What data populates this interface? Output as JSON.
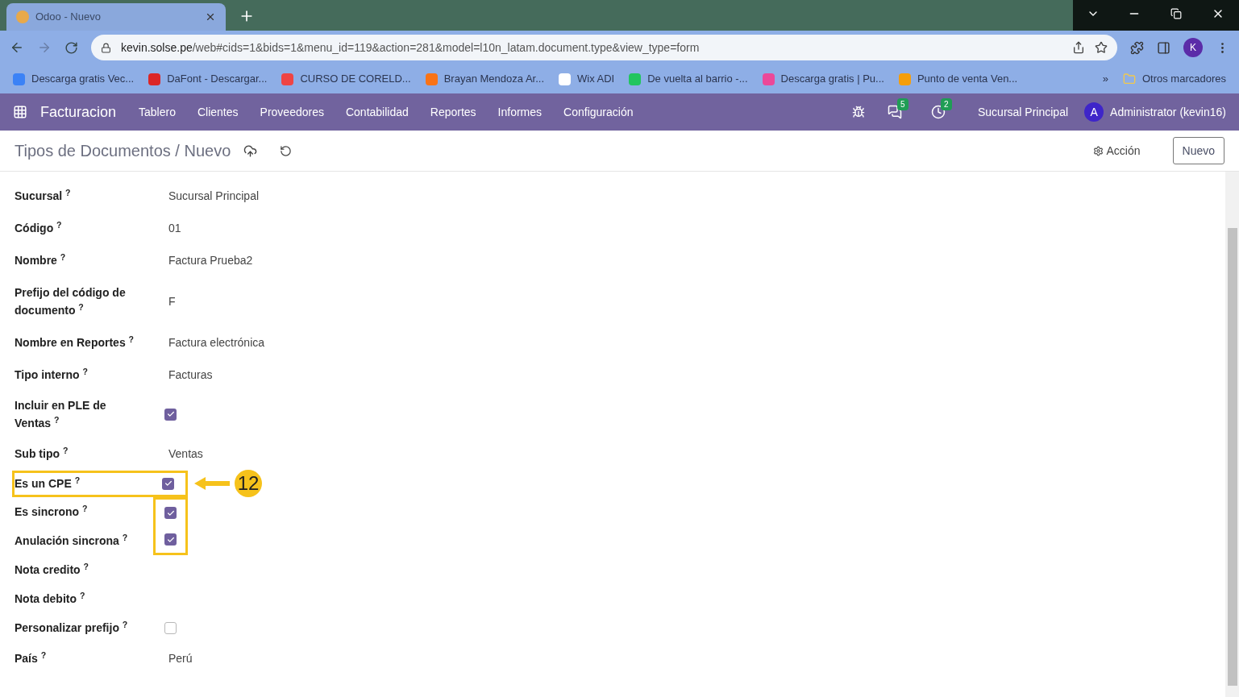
{
  "browser": {
    "tab_title": "Odoo - Nuevo",
    "url_host": "kevin.solse.pe",
    "url_path": "/web#cids=1&bids=1&menu_id=119&action=281&model=l10n_latam.document.type&view_type=form",
    "profile_initial": "K",
    "bookmarks": [
      {
        "label": "Descarga gratis Vec...",
        "color": "#3b82f6"
      },
      {
        "label": "DaFont - Descargar...",
        "color": "#dc2626"
      },
      {
        "label": "CURSO DE CORELD...",
        "color": "#ef4444"
      },
      {
        "label": "Brayan Mendoza Ar...",
        "color": "#f97316"
      },
      {
        "label": "Wix ADI",
        "color": "#ffffff"
      },
      {
        "label": "De vuelta al barrio -...",
        "color": "#22c55e"
      },
      {
        "label": "Descarga gratis | Pu...",
        "color": "#ec4899"
      },
      {
        "label": "Punto de venta Ven...",
        "color": "#f59e0b"
      }
    ],
    "more": "»",
    "other_bookmarks": "Otros marcadores"
  },
  "navbar": {
    "app": "Facturacion",
    "menu": [
      "Tablero",
      "Clientes",
      "Proveedores",
      "Contabilidad",
      "Reportes",
      "Informes",
      "Configuración"
    ],
    "messages_count": "5",
    "activities_count": "2",
    "company": "Sucursal Principal",
    "user_initial": "A",
    "user": "Administrator (kevin16)"
  },
  "control_panel": {
    "breadcrumb": "Tipos de Documentos / Nuevo",
    "action": "Acción",
    "new_button": "Nuevo"
  },
  "fields": [
    {
      "kind": "text",
      "label": "Sucursal $^{?}$",
      "value": "Sucursal Principal"
    },
    {
      "kind": "text",
      "label": "Código $^{?}$",
      "value": "01"
    },
    {
      "kind": "text",
      "label": "Nombre $^{?}$",
      "value": "Factura Prueba2"
    },
    {
      "kind": "text",
      "label": "Prefijo del código de documento $^{?}$",
      "value": "F"
    },
    {
      "kind": "text",
      "label": "Nombre en Reportes $^{?}$",
      "value": "Factura electrónica"
    },
    {
      "kind": "text",
      "label": "Tipo interno $^{?}$",
      "value": "Facturas"
    },
    {
      "kind": "checkbox",
      "label": "Incluir en PLE de Ventas $^{?}$",
      "checked": true
    },
    {
      "kind": "text",
      "label": "Sub tipo $^{?}$",
      "value": "Ventas"
    },
    {
      "kind": "checkbox",
      "label": "Es un CPE $^{?}$",
      "checked": true,
      "framed_row": true
    },
    {
      "kind": "checkbox",
      "label": "Es sincrono $^{?}$",
      "checked": true,
      "framed_check": true
    },
    {
      "kind": "checkbox",
      "label": "Anulación sincrona $^{?}$",
      "checked": true,
      "framed_check": true
    },
    {
      "kind": "empty",
      "label": "Nota credito $^{?}$"
    },
    {
      "kind": "empty",
      "label": "Nota debito $^{?}$"
    },
    {
      "kind": "checkbox",
      "label": "Personalizar prefijo $^{?}$",
      "checked": false
    },
    {
      "kind": "text",
      "label": "País $^{?}$",
      "value": "Perú"
    }
  ],
  "callout": {
    "number": "12"
  }
}
